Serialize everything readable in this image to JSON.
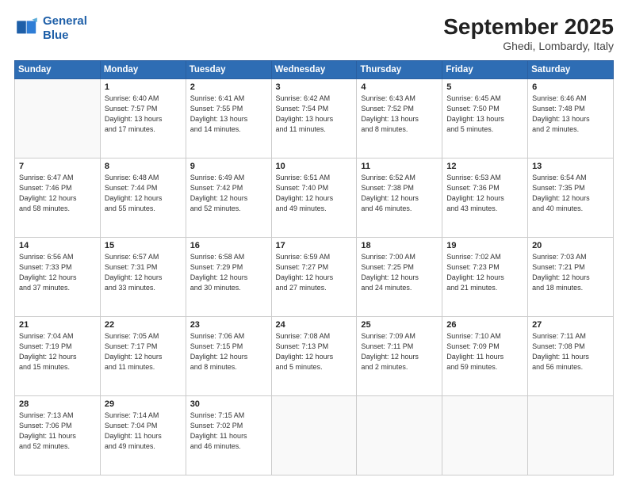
{
  "header": {
    "logo_line1": "General",
    "logo_line2": "Blue",
    "month_title": "September 2025",
    "location": "Ghedi, Lombardy, Italy"
  },
  "weekdays": [
    "Sunday",
    "Monday",
    "Tuesday",
    "Wednesday",
    "Thursday",
    "Friday",
    "Saturday"
  ],
  "weeks": [
    [
      {
        "day": "",
        "info": ""
      },
      {
        "day": "1",
        "info": "Sunrise: 6:40 AM\nSunset: 7:57 PM\nDaylight: 13 hours\nand 17 minutes."
      },
      {
        "day": "2",
        "info": "Sunrise: 6:41 AM\nSunset: 7:55 PM\nDaylight: 13 hours\nand 14 minutes."
      },
      {
        "day": "3",
        "info": "Sunrise: 6:42 AM\nSunset: 7:54 PM\nDaylight: 13 hours\nand 11 minutes."
      },
      {
        "day": "4",
        "info": "Sunrise: 6:43 AM\nSunset: 7:52 PM\nDaylight: 13 hours\nand 8 minutes."
      },
      {
        "day": "5",
        "info": "Sunrise: 6:45 AM\nSunset: 7:50 PM\nDaylight: 13 hours\nand 5 minutes."
      },
      {
        "day": "6",
        "info": "Sunrise: 6:46 AM\nSunset: 7:48 PM\nDaylight: 13 hours\nand 2 minutes."
      }
    ],
    [
      {
        "day": "7",
        "info": "Sunrise: 6:47 AM\nSunset: 7:46 PM\nDaylight: 12 hours\nand 58 minutes."
      },
      {
        "day": "8",
        "info": "Sunrise: 6:48 AM\nSunset: 7:44 PM\nDaylight: 12 hours\nand 55 minutes."
      },
      {
        "day": "9",
        "info": "Sunrise: 6:49 AM\nSunset: 7:42 PM\nDaylight: 12 hours\nand 52 minutes."
      },
      {
        "day": "10",
        "info": "Sunrise: 6:51 AM\nSunset: 7:40 PM\nDaylight: 12 hours\nand 49 minutes."
      },
      {
        "day": "11",
        "info": "Sunrise: 6:52 AM\nSunset: 7:38 PM\nDaylight: 12 hours\nand 46 minutes."
      },
      {
        "day": "12",
        "info": "Sunrise: 6:53 AM\nSunset: 7:36 PM\nDaylight: 12 hours\nand 43 minutes."
      },
      {
        "day": "13",
        "info": "Sunrise: 6:54 AM\nSunset: 7:35 PM\nDaylight: 12 hours\nand 40 minutes."
      }
    ],
    [
      {
        "day": "14",
        "info": "Sunrise: 6:56 AM\nSunset: 7:33 PM\nDaylight: 12 hours\nand 37 minutes."
      },
      {
        "day": "15",
        "info": "Sunrise: 6:57 AM\nSunset: 7:31 PM\nDaylight: 12 hours\nand 33 minutes."
      },
      {
        "day": "16",
        "info": "Sunrise: 6:58 AM\nSunset: 7:29 PM\nDaylight: 12 hours\nand 30 minutes."
      },
      {
        "day": "17",
        "info": "Sunrise: 6:59 AM\nSunset: 7:27 PM\nDaylight: 12 hours\nand 27 minutes."
      },
      {
        "day": "18",
        "info": "Sunrise: 7:00 AM\nSunset: 7:25 PM\nDaylight: 12 hours\nand 24 minutes."
      },
      {
        "day": "19",
        "info": "Sunrise: 7:02 AM\nSunset: 7:23 PM\nDaylight: 12 hours\nand 21 minutes."
      },
      {
        "day": "20",
        "info": "Sunrise: 7:03 AM\nSunset: 7:21 PM\nDaylight: 12 hours\nand 18 minutes."
      }
    ],
    [
      {
        "day": "21",
        "info": "Sunrise: 7:04 AM\nSunset: 7:19 PM\nDaylight: 12 hours\nand 15 minutes."
      },
      {
        "day": "22",
        "info": "Sunrise: 7:05 AM\nSunset: 7:17 PM\nDaylight: 12 hours\nand 11 minutes."
      },
      {
        "day": "23",
        "info": "Sunrise: 7:06 AM\nSunset: 7:15 PM\nDaylight: 12 hours\nand 8 minutes."
      },
      {
        "day": "24",
        "info": "Sunrise: 7:08 AM\nSunset: 7:13 PM\nDaylight: 12 hours\nand 5 minutes."
      },
      {
        "day": "25",
        "info": "Sunrise: 7:09 AM\nSunset: 7:11 PM\nDaylight: 12 hours\nand 2 minutes."
      },
      {
        "day": "26",
        "info": "Sunrise: 7:10 AM\nSunset: 7:09 PM\nDaylight: 11 hours\nand 59 minutes."
      },
      {
        "day": "27",
        "info": "Sunrise: 7:11 AM\nSunset: 7:08 PM\nDaylight: 11 hours\nand 56 minutes."
      }
    ],
    [
      {
        "day": "28",
        "info": "Sunrise: 7:13 AM\nSunset: 7:06 PM\nDaylight: 11 hours\nand 52 minutes."
      },
      {
        "day": "29",
        "info": "Sunrise: 7:14 AM\nSunset: 7:04 PM\nDaylight: 11 hours\nand 49 minutes."
      },
      {
        "day": "30",
        "info": "Sunrise: 7:15 AM\nSunset: 7:02 PM\nDaylight: 11 hours\nand 46 minutes."
      },
      {
        "day": "",
        "info": ""
      },
      {
        "day": "",
        "info": ""
      },
      {
        "day": "",
        "info": ""
      },
      {
        "day": "",
        "info": ""
      }
    ]
  ]
}
